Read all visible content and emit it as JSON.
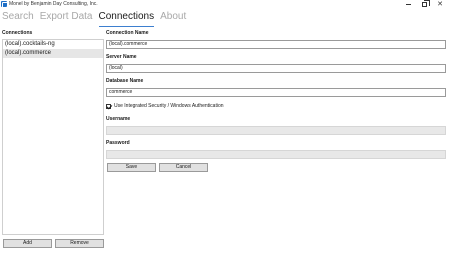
{
  "window": {
    "title": "Monel by Benjamin Day Consulting, Inc.",
    "min_glyph": "",
    "close_glyph": "✕"
  },
  "nav": {
    "tabs": [
      {
        "label": "Search",
        "active": false
      },
      {
        "label": "Export Data",
        "active": false
      },
      {
        "label": "Connections",
        "active": true
      },
      {
        "label": "About",
        "active": false
      }
    ]
  },
  "connections": {
    "heading": "Connections",
    "items": [
      {
        "label": "(local).cocktails-ng",
        "selected": false
      },
      {
        "label": "(local).commerce",
        "selected": true
      }
    ],
    "add_label": "Add",
    "remove_label": "Remove"
  },
  "form": {
    "connection_name": {
      "label": "Connection Name",
      "value": "(local).commerce"
    },
    "server_name": {
      "label": "Server Name",
      "value": "(local)"
    },
    "database_name": {
      "label": "Database Name",
      "value": "commerce"
    },
    "integrated_security": {
      "label": "Use Integrated Security / Windows Authentication",
      "checked": true
    },
    "username": {
      "label": "Username",
      "value": ""
    },
    "password": {
      "label": "Password",
      "value": ""
    },
    "save_label": "Save",
    "cancel_label": "Cancel"
  },
  "colors": {
    "accent": "#3d7fcf",
    "inactive_tab": "#a8a8a8",
    "selected_row": "#e6e6e6",
    "disabled_field": "#e8e8e8"
  }
}
